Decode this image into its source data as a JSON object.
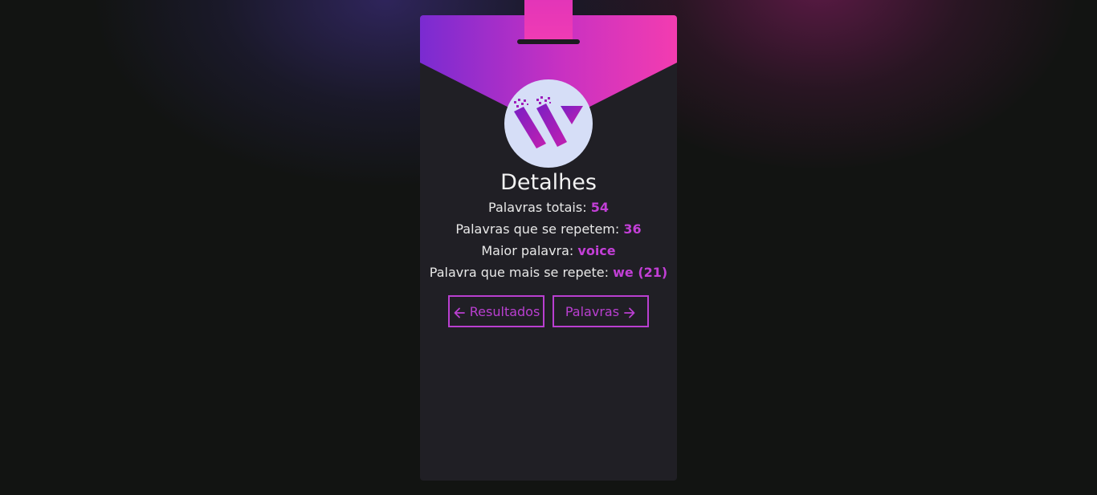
{
  "card": {
    "title": "Detalhes",
    "logo_icon": "wordcount-logo-icon",
    "stats": [
      {
        "label": "Palavras totais: ",
        "value": "54"
      },
      {
        "label": "Palavras que se repetem: ",
        "value": "36"
      },
      {
        "label": "Maior palavra: ",
        "value": "voice"
      },
      {
        "label": "Palavra que mais se repete: ",
        "value": "we (21)"
      }
    ],
    "buttons": {
      "back_label": "Resultados",
      "back_icon": "arrow-left-icon",
      "next_label": "Palavras",
      "next_icon": "arrow-right-icon"
    }
  },
  "colors": {
    "accent": "#c23fd6",
    "gradient_start": "#7a2bd1",
    "gradient_end": "#f33cb0",
    "card_bg": "#201f25",
    "page_bg": "#121412"
  }
}
